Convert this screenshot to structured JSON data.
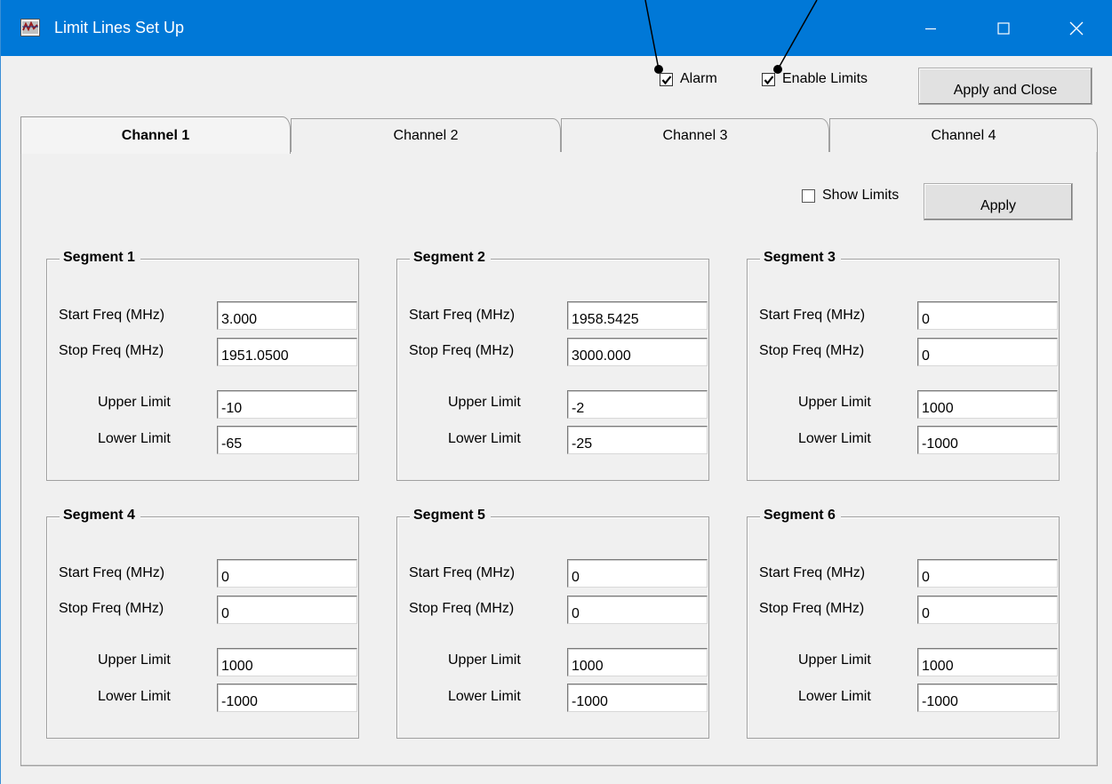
{
  "window": {
    "title": "Limit Lines Set Up",
    "accent": "#0078d7"
  },
  "top_controls": {
    "alarm_label": "Alarm",
    "alarm_checked": true,
    "enable_limits_label": "Enable Limits",
    "enable_limits_checked": true,
    "apply_close_label": "Apply and Close"
  },
  "tabs": [
    {
      "label": "Channel 1",
      "active": true
    },
    {
      "label": "Channel 2",
      "active": false
    },
    {
      "label": "Channel 3",
      "active": false
    },
    {
      "label": "Channel 4",
      "active": false
    }
  ],
  "panel": {
    "show_limits_label": "Show Limits",
    "show_limits_checked": false,
    "apply_label": "Apply"
  },
  "labels": {
    "start_freq": "Start Freq (MHz)",
    "stop_freq": "Stop Freq (MHz)",
    "upper_limit": "Upper Limit",
    "lower_limit": "Lower Limit"
  },
  "segments": [
    {
      "title": "Segment 1",
      "start_freq": "3.000",
      "stop_freq": "1951.0500",
      "upper_limit": "-10",
      "lower_limit": "-65"
    },
    {
      "title": "Segment 2",
      "start_freq": "1958.5425",
      "stop_freq": "3000.000",
      "upper_limit": "-2",
      "lower_limit": "-25"
    },
    {
      "title": "Segment 3",
      "start_freq": "0",
      "stop_freq": "0",
      "upper_limit": "1000",
      "lower_limit": "-1000"
    },
    {
      "title": "Segment 4",
      "start_freq": "0",
      "stop_freq": "0",
      "upper_limit": "1000",
      "lower_limit": "-1000"
    },
    {
      "title": "Segment 5",
      "start_freq": "0",
      "stop_freq": "0",
      "upper_limit": "1000",
      "lower_limit": "-1000"
    },
    {
      "title": "Segment 6",
      "start_freq": "0",
      "stop_freq": "0",
      "upper_limit": "1000",
      "lower_limit": "-1000"
    }
  ]
}
